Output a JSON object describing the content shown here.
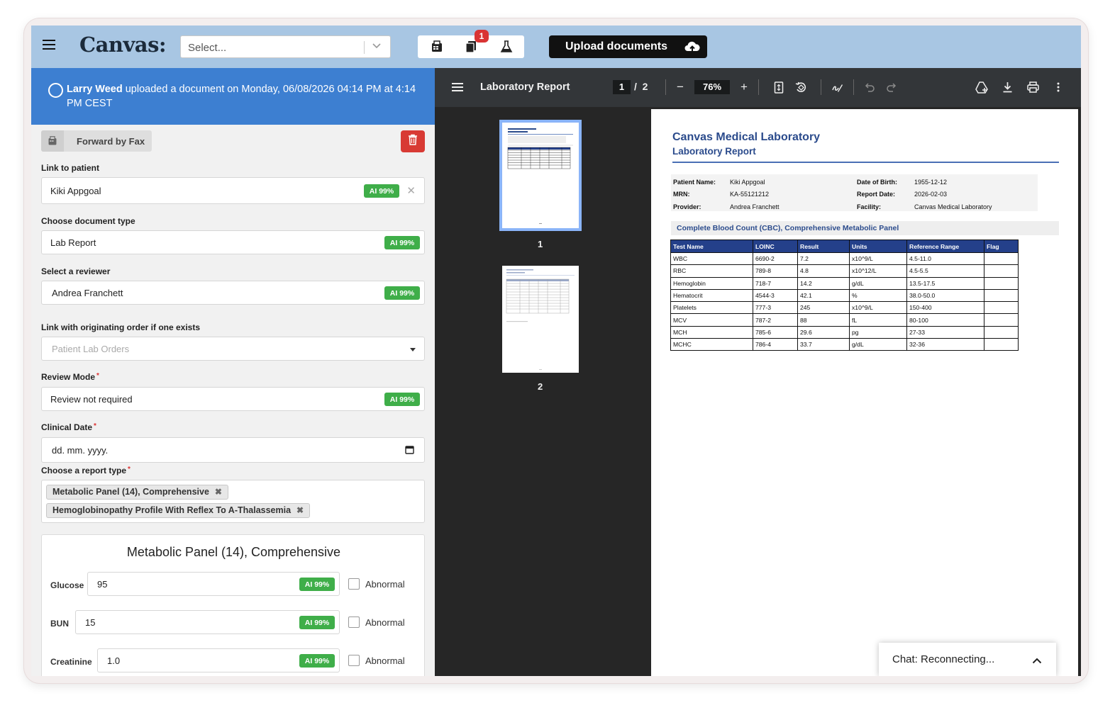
{
  "header": {
    "logo": "Canvas:",
    "select_placeholder": "Select...",
    "notification_count": "1",
    "upload_label": "Upload documents"
  },
  "notice": {
    "user": "Larry Weed",
    "message": " uploaded a document on Monday, 06/08/2026 04:14 PM at 4:14 PM CEST"
  },
  "form": {
    "fax_label": "Forward by Fax",
    "ai_label": "AI 99%",
    "link_patient_label": "Link to patient",
    "patient_value": "Kiki Appgoal",
    "doc_type_label": "Choose document type",
    "doc_type_value": "Lab Report",
    "reviewer_label": "Select a reviewer",
    "reviewer_value": "Andrea Franchett",
    "order_label": "Link with originating order if one exists",
    "order_placeholder": "Patient Lab Orders",
    "review_mode_label": "Review Mode",
    "review_mode_value": "Review not required",
    "clinical_date_label": "Clinical Date",
    "clinical_date_placeholder": "dd. mm. yyyy.",
    "report_type_label": "Choose a report type",
    "report_types": [
      "Metabolic Panel (14), Comprehensive",
      "Hemoglobinopathy Profile With Reflex To A-Thalassemia"
    ],
    "required_mark": "*"
  },
  "panel": {
    "title": "Metabolic Panel (14), Comprehensive",
    "abnormal_label": "Abnormal",
    "rows": [
      {
        "label": "Glucose",
        "value": "95"
      },
      {
        "label": "BUN",
        "value": "15"
      },
      {
        "label": "Creatinine",
        "value": "1.0"
      }
    ]
  },
  "viewer": {
    "title": "Laboratory Report",
    "current_page": "1",
    "page_separator": "/",
    "total_pages": "2",
    "zoom": "76%",
    "thumb_labels": [
      "1",
      "2"
    ]
  },
  "document": {
    "lab_name": "Canvas Medical Laboratory",
    "report_title": "Laboratory Report",
    "meta": {
      "patient_name_label": "Patient Name:",
      "patient_name": "Kiki Appgoal",
      "dob_label": "Date of Birth:",
      "dob": "1955-12-12",
      "mrn_label": "MRN:",
      "mrn": "KA-55121212",
      "report_date_label": "Report Date:",
      "report_date": "2026-02-03",
      "provider_label": "Provider:",
      "provider": "Andrea Franchett",
      "facility_label": "Facility:",
      "facility": "Canvas Medical Laboratory"
    },
    "section_title": "Complete Blood Count (CBC), Comprehensive Metabolic Panel",
    "table_headers": [
      "Test Name",
      "LOINC",
      "Result",
      "Units",
      "Reference Range",
      "Flag"
    ],
    "table_rows": [
      [
        "WBC",
        "6690-2",
        "7.2",
        "x10^9/L",
        "4.5-11.0",
        ""
      ],
      [
        "RBC",
        "789-8",
        "4.8",
        "x10^12/L",
        "4.5-5.5",
        ""
      ],
      [
        "Hemoglobin",
        "718-7",
        "14.2",
        "g/dL",
        "13.5-17.5",
        ""
      ],
      [
        "Hematocrit",
        "4544-3",
        "42.1",
        "%",
        "38.0-50.0",
        ""
      ],
      [
        "Platelets",
        "777-3",
        "245",
        "x10^9/L",
        "150-400",
        ""
      ],
      [
        "MCV",
        "787-2",
        "88",
        "fL",
        "80-100",
        ""
      ],
      [
        "MCH",
        "785-6",
        "29.6",
        "pg",
        "27-33",
        ""
      ],
      [
        "MCHC",
        "786-4",
        "33.7",
        "g/dL",
        "32-36",
        ""
      ]
    ]
  },
  "chat": {
    "status": "Chat: Reconnecting..."
  }
}
